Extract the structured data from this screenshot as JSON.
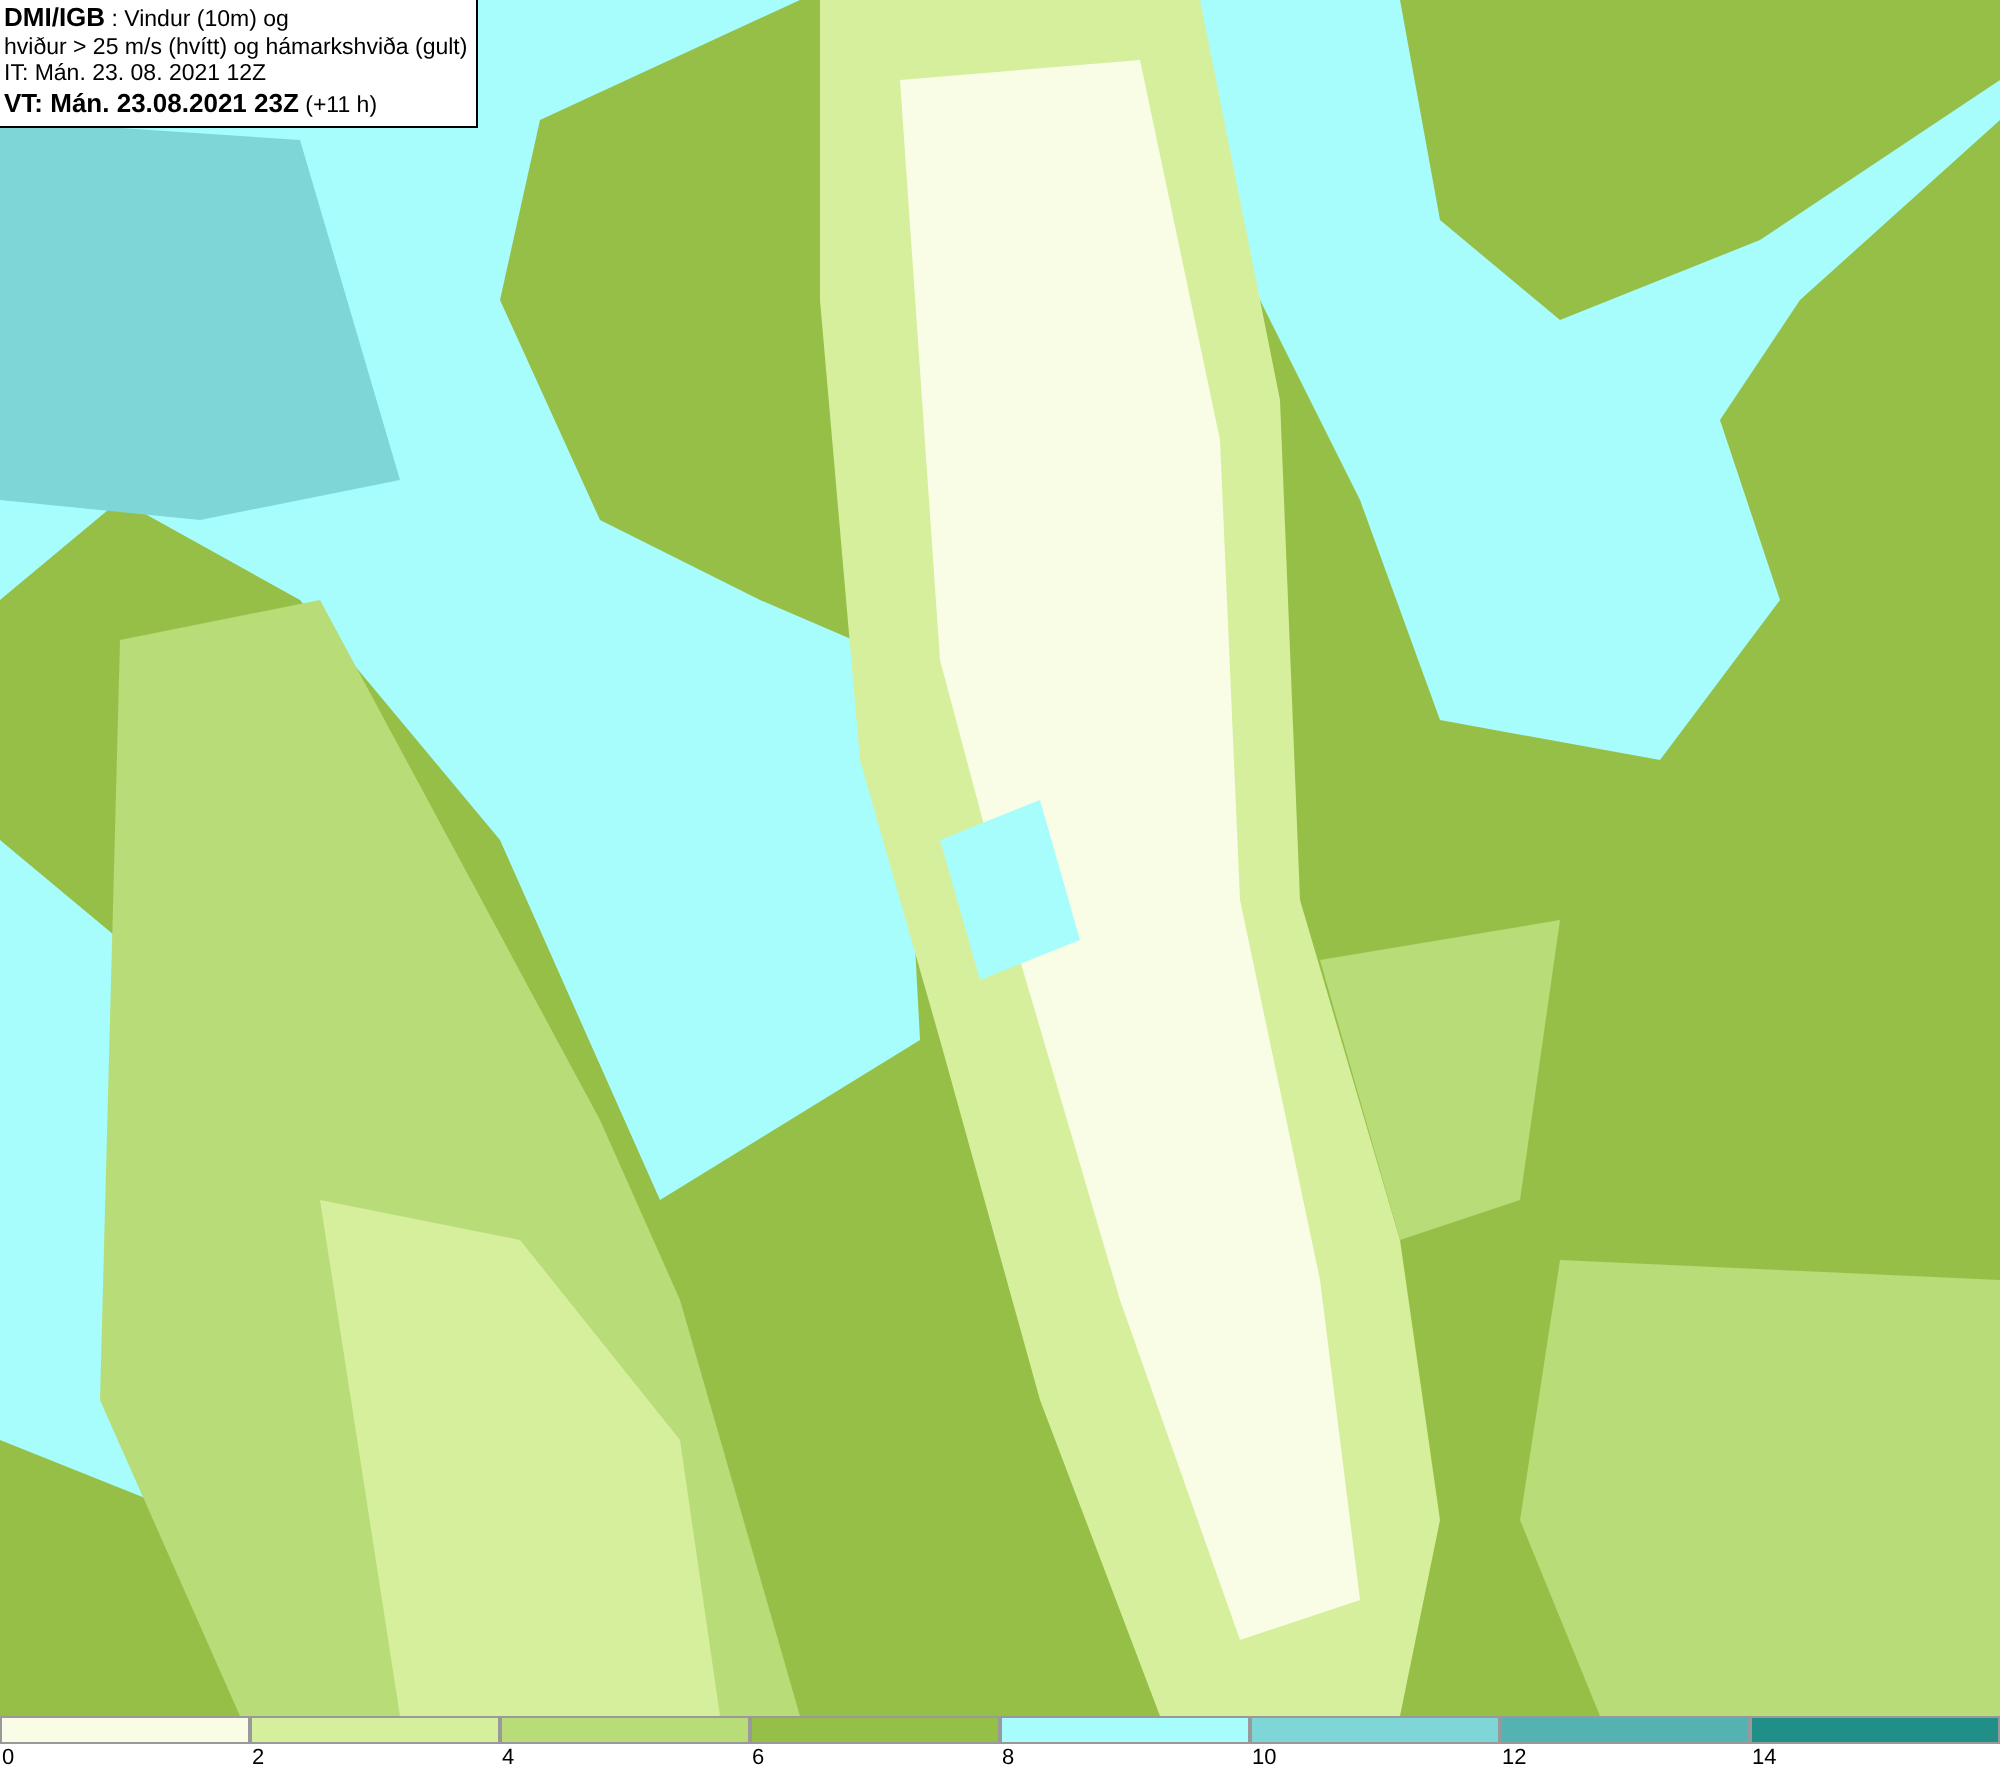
{
  "header": {
    "lines": [
      "**DMI/IGB** : Vindur (10m) og",
      "hviður > 25 m/s (hvítt) og hámarkshviða (gult)",
      "IT: Mán. 23. 08. 2021 12Z",
      "**VT: Mán. 23.08.2021 23Z** (+11 h)"
    ]
  },
  "legend": {
    "segments": [
      {
        "color": "#fafde6",
        "label": "0"
      },
      {
        "color": "#d6ef9c",
        "label": "2"
      },
      {
        "color": "#b8dc78",
        "label": "4"
      },
      {
        "color": "#96bf48",
        "label": "6"
      },
      {
        "color": "#a6fdfc",
        "label": "8"
      },
      {
        "color": "#7fd6d6",
        "label": "10"
      },
      {
        "color": "#55b2b2",
        "label": "12"
      },
      {
        "color": "#1f8f88",
        "label": "14"
      }
    ]
  }
}
